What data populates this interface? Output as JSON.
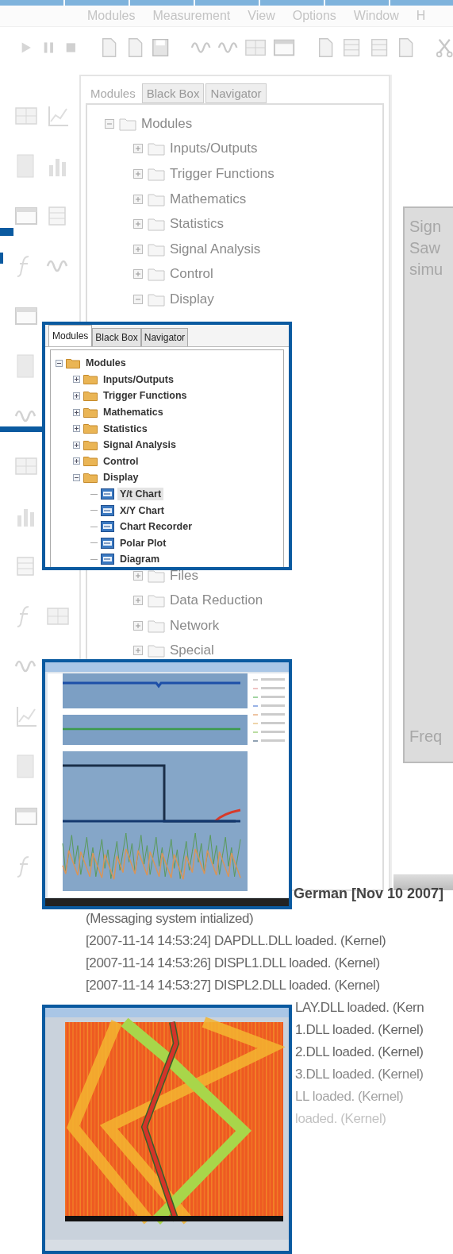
{
  "menu_bar": {
    "items": [
      "Modules",
      "Measurement",
      "View",
      "Options",
      "Window",
      "H"
    ]
  },
  "modules_panel": {
    "tabs": [
      {
        "label": "Modules",
        "selected": true
      },
      {
        "label": "Black Box",
        "selected": false
      },
      {
        "label": "Navigator",
        "selected": false
      }
    ],
    "tree_top": {
      "label": "Modules",
      "expanded": true,
      "children": [
        {
          "label": "Inputs/Outputs",
          "expanded": false
        },
        {
          "label": "Trigger Functions",
          "expanded": false
        },
        {
          "label": "Mathematics",
          "expanded": false
        },
        {
          "label": "Statistics",
          "expanded": false
        },
        {
          "label": "Signal Analysis",
          "expanded": false
        },
        {
          "label": "Control",
          "expanded": false
        },
        {
          "label": "Display",
          "expanded": true
        }
      ]
    },
    "tree_bottom": [
      {
        "label": "Files",
        "expanded": false
      },
      {
        "label": "Data Reduction",
        "expanded": false
      },
      {
        "label": "Network",
        "expanded": false
      },
      {
        "label": "Special",
        "expanded": false
      }
    ]
  },
  "right_panel": {
    "lines_top": [
      "Sign",
      "Saw",
      "simu"
    ],
    "line_bottom": "Freq"
  },
  "log": {
    "header": "German [Nov 10 2007]",
    "lines": [
      {
        "text": "(Messaging system intialized)",
        "covered": false
      },
      {
        "text": "[2007-11-14 14:53:24] DAPDLL.DLL loaded. (Kernel)",
        "covered": false
      },
      {
        "text": "[2007-11-14 14:53:26] DISPL1.DLL loaded. (Kernel)",
        "covered": false
      },
      {
        "text": "[2007-11-14 14:53:27] DISPL2.DLL loaded. (Kernel)",
        "covered": false
      },
      {
        "text": "LAY.DLL loaded. (Kern",
        "covered": true
      },
      {
        "text": "1.DLL loaded. (Kernel)",
        "covered": true
      },
      {
        "text": "2.DLL loaded. (Kernel)",
        "covered": true
      },
      {
        "text": "3.DLL loaded. (Kernel)",
        "covered": true
      },
      {
        "text": "LL loaded. (Kernel)",
        "covered": true
      },
      {
        "text": "loaded. (Kernel)",
        "covered": true
      }
    ]
  },
  "inset_tree": {
    "tabs": [
      {
        "label": "Modules",
        "selected": true
      },
      {
        "label": "Black Box",
        "selected": false
      },
      {
        "label": "Navigator",
        "selected": false
      }
    ],
    "tree": {
      "label": "Modules",
      "kind": "folder",
      "expanded": true,
      "selected": false,
      "children": [
        {
          "label": "Inputs/Outputs",
          "kind": "folder",
          "expanded": false,
          "selected": false
        },
        {
          "label": "Trigger Functions",
          "kind": "folder",
          "expanded": false,
          "selected": false
        },
        {
          "label": "Mathematics",
          "kind": "folder",
          "expanded": false,
          "selected": false
        },
        {
          "label": "Statistics",
          "kind": "folder",
          "expanded": false,
          "selected": false
        },
        {
          "label": "Signal Analysis",
          "kind": "folder",
          "expanded": false,
          "selected": false
        },
        {
          "label": "Control",
          "kind": "folder",
          "expanded": false,
          "selected": false
        },
        {
          "label": "Display",
          "kind": "folder",
          "expanded": true,
          "selected": false,
          "children": [
            {
              "label": "Y/t Chart",
              "kind": "module",
              "selected": true
            },
            {
              "label": "X/Y Chart",
              "kind": "module",
              "selected": false
            },
            {
              "label": "Chart Recorder",
              "kind": "module",
              "selected": false
            },
            {
              "label": "Polar Plot",
              "kind": "module",
              "selected": false
            },
            {
              "label": "Diagram",
              "kind": "module",
              "selected": false
            }
          ]
        }
      ]
    }
  }
}
